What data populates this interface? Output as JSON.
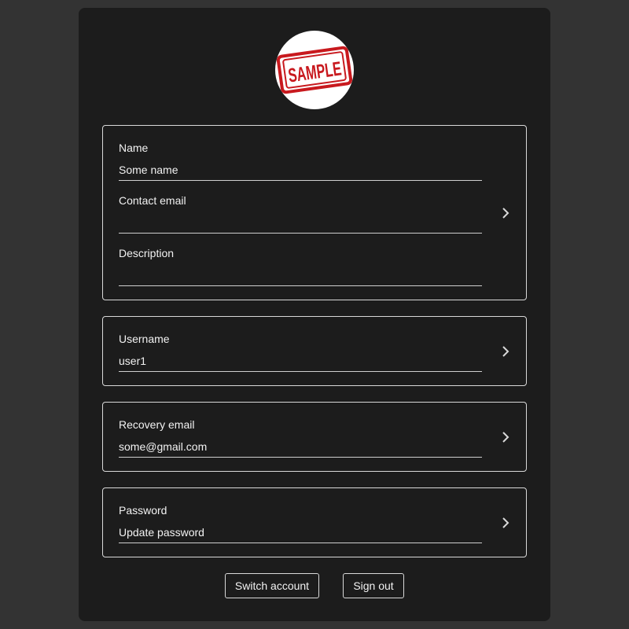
{
  "avatar": {
    "stamp_text": "SAMPLE",
    "stamp_color": "#c8191e"
  },
  "profile": {
    "name": {
      "label": "Name",
      "value": "Some name"
    },
    "contact_email": {
      "label": "Contact email",
      "value": ""
    },
    "description": {
      "label": "Description",
      "value": ""
    }
  },
  "username": {
    "label": "Username",
    "value": "user1"
  },
  "recovery": {
    "label": "Recovery email",
    "value": "some@gmail.com"
  },
  "password": {
    "label": "Password",
    "value": "Update password"
  },
  "actions": {
    "switch_account": "Switch account",
    "sign_out": "Sign out"
  },
  "icons": {
    "card_action": "chevron-right-icon"
  },
  "colors": {
    "page_background": "#333333",
    "panel_background": "#1c1c1c",
    "border": "#d9d9d9",
    "text": "#f2f2f2"
  }
}
